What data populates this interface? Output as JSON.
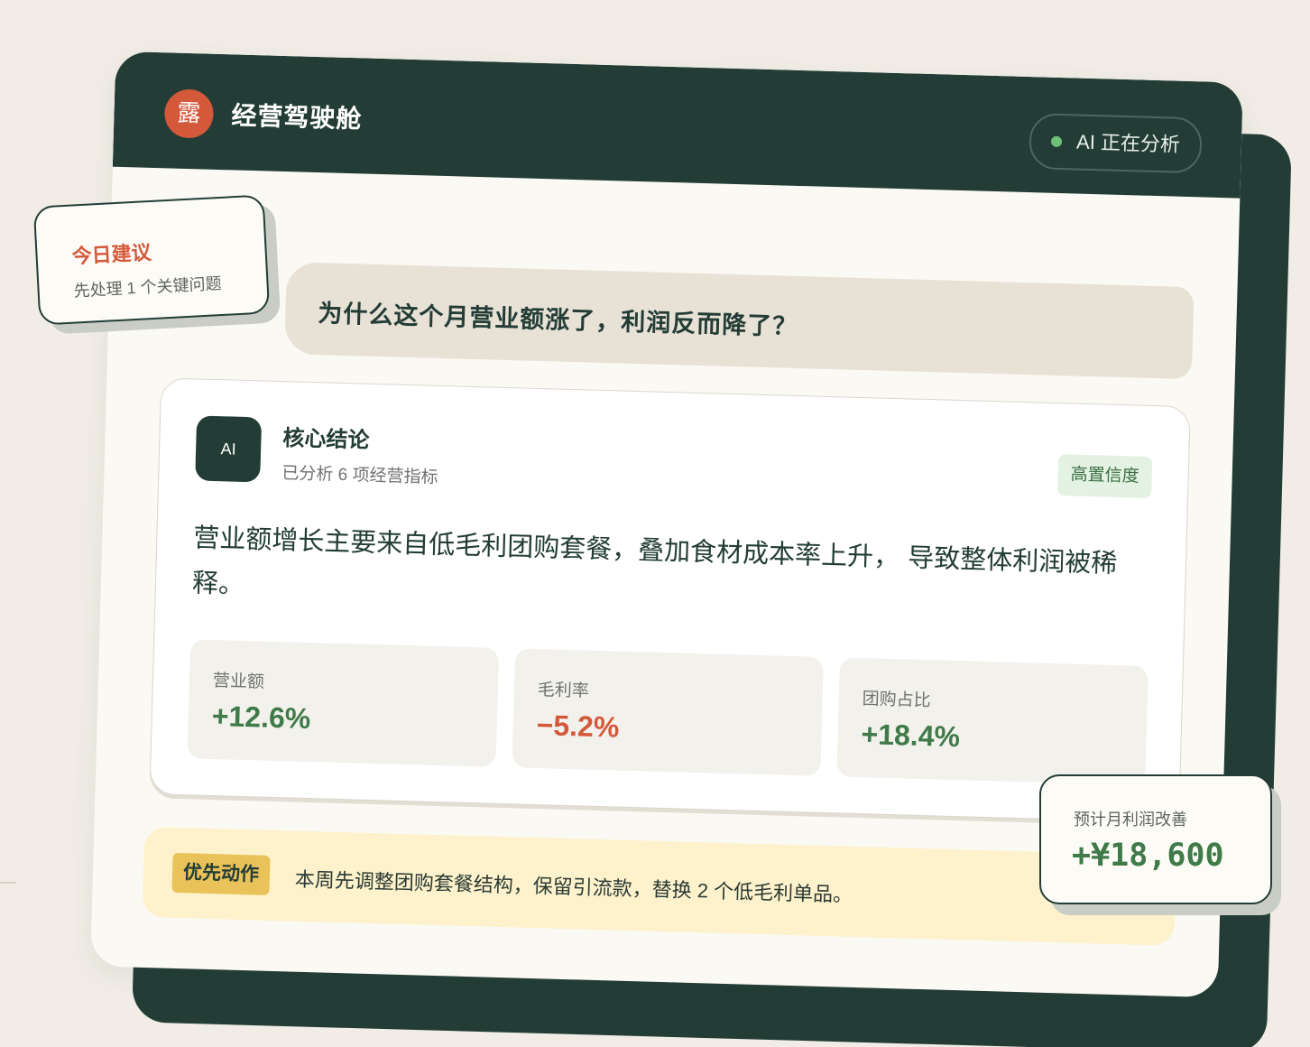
{
  "header": {
    "logo_char": "露",
    "title": "经营驾驶舱",
    "status": "AI 正在分析"
  },
  "tip": {
    "title": "今日建议",
    "subtitle": "先处理 1 个关键问题"
  },
  "question": "为什么这个月营业额涨了，利润反而降了？",
  "answer": {
    "badge": "AI",
    "title": "核心结论",
    "subtitle": "已分析 6 项经营指标",
    "confidence": "高置信度",
    "conclusion": "营业额增长主要来自低毛利团购套餐，叠加食材成本率上升， 导致整体利润被稀释。",
    "metrics": [
      {
        "label": "营业额",
        "value": "+12.6%",
        "trend": "up"
      },
      {
        "label": "毛利率",
        "value": "−5.2%",
        "trend": "down"
      },
      {
        "label": "团购占比",
        "value": "+18.4%",
        "trend": "up"
      }
    ]
  },
  "action": {
    "tag": "优先动作",
    "text": "本周先调整团购套餐结构，保留引流款，替换 2 个低毛利单品。"
  },
  "profit": {
    "label": "预计月利润改善",
    "value": "+¥18,600"
  },
  "colors": {
    "brand_dark": "#233d36",
    "accent_orange": "#d4593b",
    "positive": "#3f7a49",
    "status_green": "#6fc179",
    "highlight_yellow": "#e9c259"
  }
}
